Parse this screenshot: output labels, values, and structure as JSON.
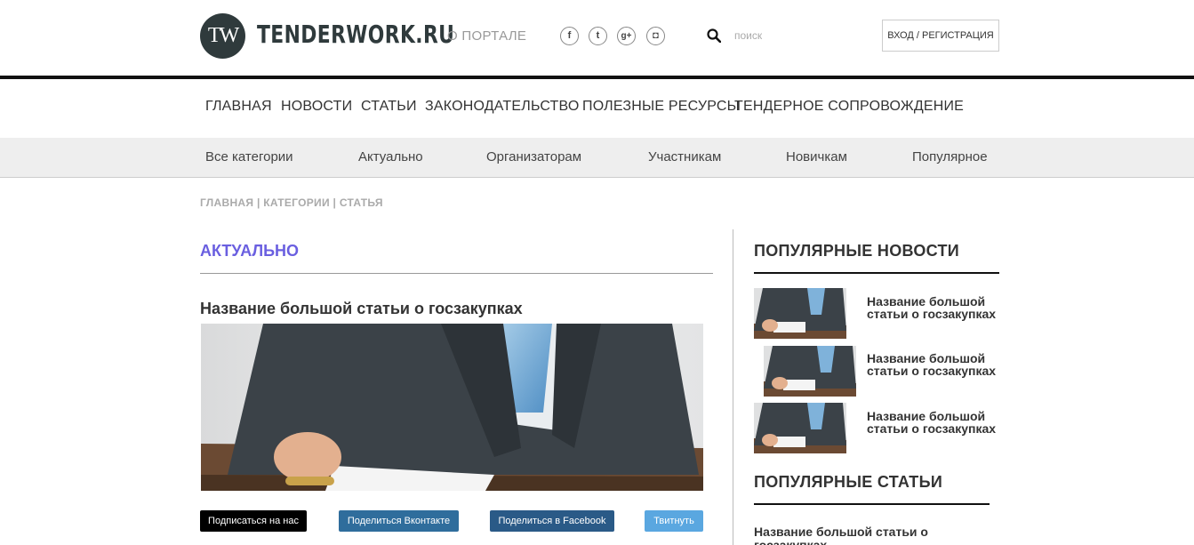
{
  "header": {
    "logo_mark": "TW",
    "logo_text": "TENDERWORK.RU",
    "about_link": "О ПОРТАЛЕ",
    "social": [
      {
        "icon": "facebook-icon",
        "glyph": "f"
      },
      {
        "icon": "twitter-icon",
        "glyph": "t"
      },
      {
        "icon": "google-plus-icon",
        "glyph": "g+"
      },
      {
        "icon": "instagram-icon",
        "glyph": "◘"
      }
    ],
    "search_placeholder": "поиск",
    "login_label": "ВХОД / РЕГИСТРАЦИЯ"
  },
  "main_nav": [
    "ГЛАВНАЯ",
    "НОВОСТИ",
    "СТАТЬИ",
    "ЗАКОНОДАТЕЛЬСТВО",
    "ПОЛЕЗНЫЕ РЕСУРСЫ",
    "ТЕНДЕРНОЕ СОПРОВОЖДЕНИЕ"
  ],
  "category_nav": [
    "Все категории",
    "Актуально",
    "Организаторам",
    "Участникам",
    "Новичкам",
    "Популярное"
  ],
  "breadcrumb": "ГЛАВНАЯ | КАТЕГОРИИ | СТАТЬЯ",
  "main": {
    "section_title": "АКТУАЛЬНО",
    "article_title": "Название большой статьи о госзакупках",
    "share_buttons": [
      "Подписаться на нас",
      "Поделиться Вконтакте",
      "Поделиться в Facebook",
      "Твитнуть"
    ]
  },
  "sidebar": {
    "popular_news_title": "ПОПУЛЯРНЫЕ НОВОСТИ",
    "popular_news": [
      "Название большой статьи о госзакупках",
      "Название большой статьи о госзакупках",
      "Название большой статьи о госзакупках"
    ],
    "popular_articles_title": "ПОПУЛЯРНЫЕ СТАТЬИ",
    "popular_articles": [
      "Название большой статьи о госзакупках"
    ]
  },
  "colors": {
    "accent": "#6a5fe0",
    "subscribe": "#000000",
    "vk": "#2f6d9c",
    "facebook": "#2a5a87",
    "twitter": "#5aa7e0"
  }
}
